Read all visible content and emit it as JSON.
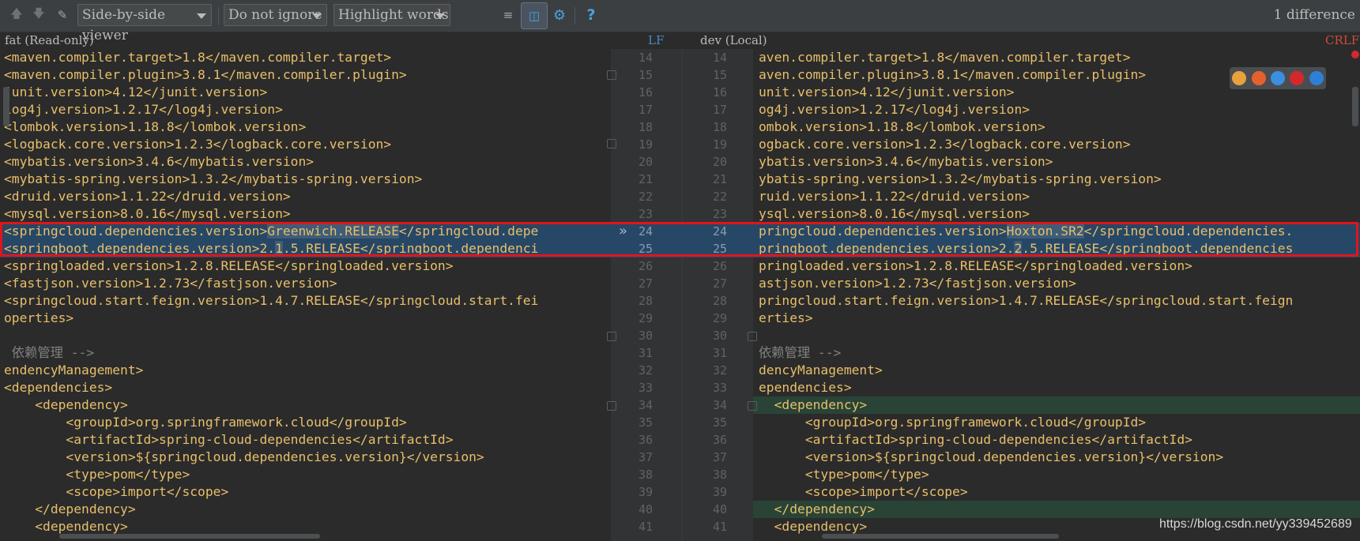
{
  "toolbar": {
    "viewer_mode": "Side-by-side viewer",
    "whitespace_mode": "Do not ignore",
    "highlight_mode": "Highlight words",
    "difference_count": "1 difference",
    "help_label": "?"
  },
  "left": {
    "title": "fat (Read-only)",
    "line_ending": "LF"
  },
  "right": {
    "title": "dev (Local)",
    "line_ending": "CRLF"
  },
  "left_lines": [
    {
      "n": "14",
      "t": "<maven.compiler.target>1.8</maven.compiler.target>"
    },
    {
      "n": "15",
      "t": "<maven.compiler.plugin>3.8.1</maven.compiler.plugin>"
    },
    {
      "n": "16",
      "t": "junit.version>4.12</junit.version>"
    },
    {
      "n": "17",
      "t": "log4j.version>1.2.17</log4j.version>"
    },
    {
      "n": "18",
      "t": "<lombok.version>1.18.8</lombok.version>"
    },
    {
      "n": "19",
      "t": "<logback.core.version>1.2.3</logback.core.version>"
    },
    {
      "n": "20",
      "t": "<mybatis.version>3.4.6</mybatis.version>"
    },
    {
      "n": "21",
      "t": "<mybatis-spring.version>1.3.2</mybatis-spring.version>"
    },
    {
      "n": "22",
      "t": "<druid.version>1.1.22</druid.version>"
    },
    {
      "n": "23",
      "t": "<mysql.version>8.0.16</mysql.version>"
    },
    {
      "n": "24",
      "pre": "<springcloud.dependencies.version>",
      "hl": "Greenwich.RELEASE",
      "post": "</springcloud.depe",
      "changed": true
    },
    {
      "n": "25",
      "pre": "<springboot.dependencies.version>2.",
      "hl": "1",
      "post": ".5.RELEASE</springboot.dependenci",
      "changed": true
    },
    {
      "n": "26",
      "t": "<springloaded.version>1.2.8.RELEASE</springloaded.version>"
    },
    {
      "n": "27",
      "t": "<fastjson.version>1.2.73</fastjson.version>"
    },
    {
      "n": "28",
      "t": "<springcloud.start.feign.version>1.4.7.RELEASE</springcloud.start.fei"
    },
    {
      "n": "29",
      "t": "operties>"
    },
    {
      "n": "30",
      "t": ""
    },
    {
      "n": "31",
      "t": " 依赖管理 -->",
      "comment": true
    },
    {
      "n": "32",
      "t": "endencyManagement>"
    },
    {
      "n": "33",
      "t": "<dependencies>"
    },
    {
      "n": "34",
      "t": "    <dependency>"
    },
    {
      "n": "35",
      "t": "        <groupId>org.springframework.cloud</groupId>"
    },
    {
      "n": "36",
      "t": "        <artifactId>spring-cloud-dependencies</artifactId>"
    },
    {
      "n": "37",
      "t": "        <version>${springcloud.dependencies.version}</version>"
    },
    {
      "n": "38",
      "t": "        <type>pom</type>"
    },
    {
      "n": "39",
      "t": "        <scope>import</scope>"
    },
    {
      "n": "40",
      "t": "    </dependency>"
    },
    {
      "n": "41",
      "t": "    <dependency>"
    }
  ],
  "right_lines": [
    {
      "n": "14",
      "t": "aven.compiler.target>1.8</maven.compiler.target>"
    },
    {
      "n": "15",
      "t": "aven.compiler.plugin>3.8.1</maven.compiler.plugin>"
    },
    {
      "n": "16",
      "t": "unit.version>4.12</junit.version>"
    },
    {
      "n": "17",
      "t": "og4j.version>1.2.17</log4j.version>"
    },
    {
      "n": "18",
      "t": "ombok.version>1.18.8</lombok.version>"
    },
    {
      "n": "19",
      "t": "ogback.core.version>1.2.3</logback.core.version>"
    },
    {
      "n": "20",
      "t": "ybatis.version>3.4.6</mybatis.version>"
    },
    {
      "n": "21",
      "t": "ybatis-spring.version>1.3.2</mybatis-spring.version>"
    },
    {
      "n": "22",
      "t": "ruid.version>1.1.22</druid.version>"
    },
    {
      "n": "23",
      "t": "ysql.version>8.0.16</mysql.version>"
    },
    {
      "n": "24",
      "pre": "pringcloud.dependencies.version>",
      "hl": "Hoxton.SR2",
      "post": "</springcloud.dependencies.",
      "changed": true
    },
    {
      "n": "25",
      "pre": "pringboot.dependencies.version>2.",
      "hl": "2",
      "post": ".5.RELEASE</springboot.dependencies",
      "changed": true
    },
    {
      "n": "26",
      "t": "pringloaded.version>1.2.8.RELEASE</springloaded.version>"
    },
    {
      "n": "27",
      "t": "astjson.version>1.2.73</fastjson.version>"
    },
    {
      "n": "28",
      "t": "pringcloud.start.feign.version>1.4.7.RELEASE</springcloud.start.feign"
    },
    {
      "n": "29",
      "t": "erties>"
    },
    {
      "n": "30",
      "t": ""
    },
    {
      "n": "31",
      "t": "依赖管理 -->",
      "comment": true
    },
    {
      "n": "32",
      "t": "dencyManagement>"
    },
    {
      "n": "33",
      "t": "ependencies>"
    },
    {
      "n": "34",
      "t": "  <dependency>",
      "modified": true
    },
    {
      "n": "35",
      "t": "      <groupId>org.springframework.cloud</groupId>"
    },
    {
      "n": "36",
      "t": "      <artifactId>spring-cloud-dependencies</artifactId>"
    },
    {
      "n": "37",
      "t": "      <version>${springcloud.dependencies.version}</version>"
    },
    {
      "n": "38",
      "t": "      <type>pom</type>"
    },
    {
      "n": "39",
      "t": "      <scope>import</scope>"
    },
    {
      "n": "40",
      "t": "  </dependency>",
      "modified": true
    },
    {
      "n": "41",
      "t": "  <dependency>"
    }
  ],
  "watermark": "https://blog.csdn.net/yy339452689",
  "colors": {
    "changed_bg": "#274766",
    "word_hl": "#3f5d78",
    "tag": "#e8bf6a",
    "marker": "#e0151b"
  }
}
